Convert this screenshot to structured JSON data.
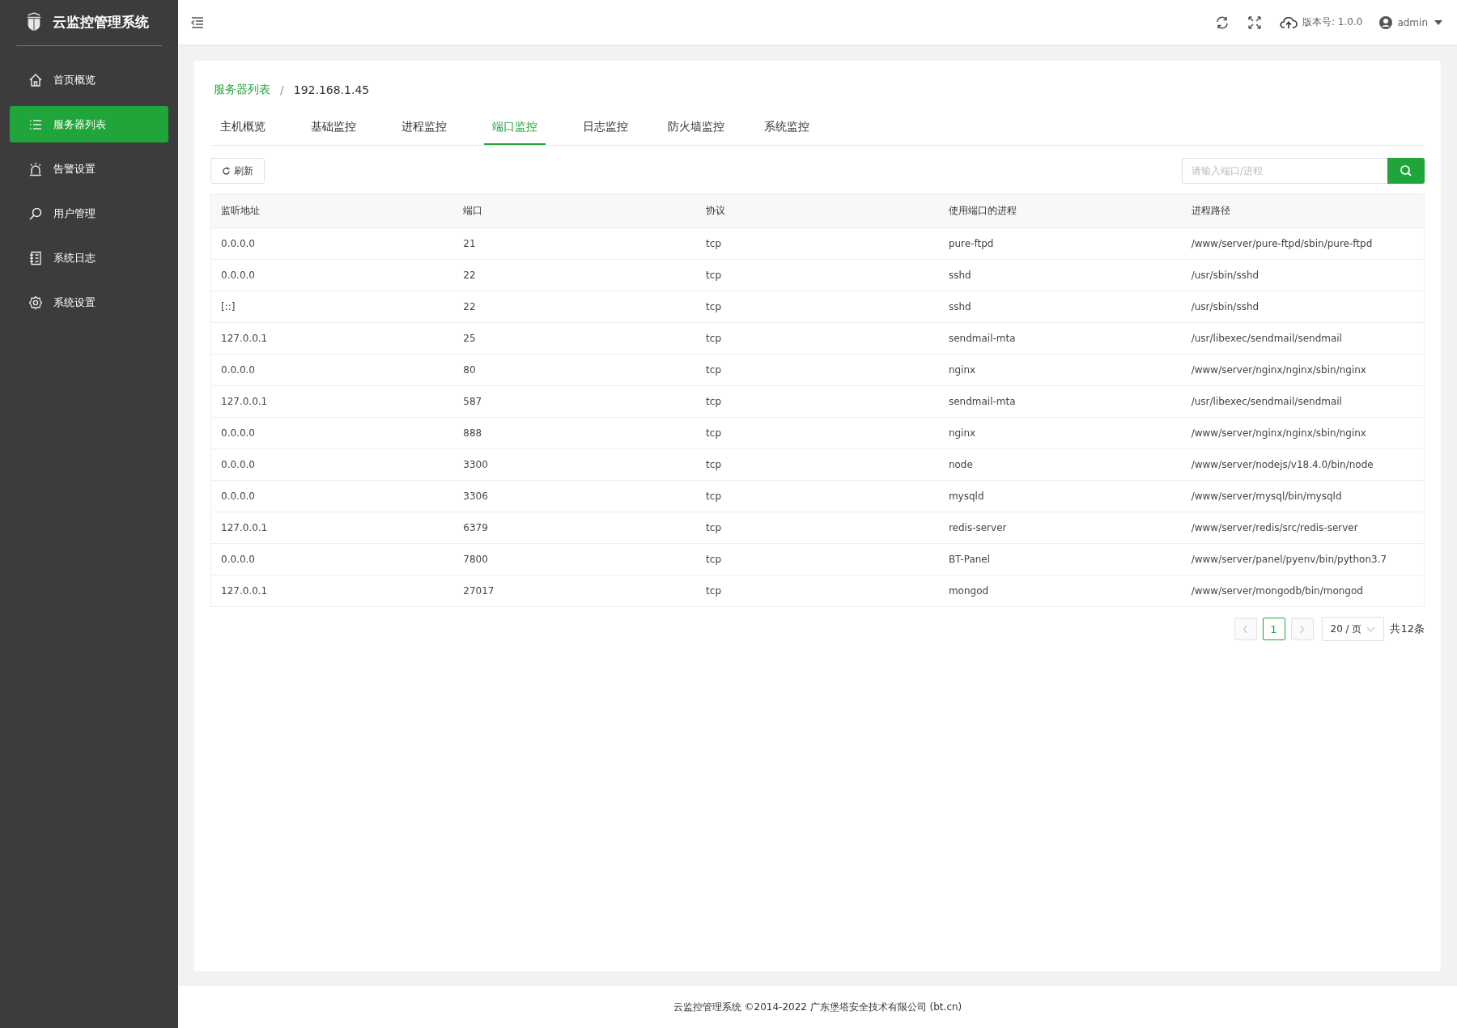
{
  "sidebar": {
    "title": "云监控管理系统",
    "items": [
      {
        "label": "首页概览",
        "selected": false
      },
      {
        "label": "服务器列表",
        "selected": true
      },
      {
        "label": "告警设置",
        "selected": false
      },
      {
        "label": "用户管理",
        "selected": false
      },
      {
        "label": "系统日志",
        "selected": false
      },
      {
        "label": "系统设置",
        "selected": false
      }
    ]
  },
  "header": {
    "version": "版本号: 1.0.0",
    "user": "admin"
  },
  "breadcrumb": {
    "items": [
      "服务器列表",
      "192.168.1.45"
    ],
    "separator": "/"
  },
  "tabs": [
    {
      "label": "主机概览",
      "selected": false
    },
    {
      "label": "基础监控",
      "selected": false
    },
    {
      "label": "进程监控",
      "selected": false
    },
    {
      "label": "端口监控",
      "selected": true
    },
    {
      "label": "日志监控",
      "selected": false
    },
    {
      "label": "防火墙监控",
      "selected": false
    },
    {
      "label": "系统监控",
      "selected": false
    }
  ],
  "refresh_button": "刷新",
  "search": {
    "placeholder": "请输入端口/进程"
  },
  "table": {
    "columns": [
      "监听地址",
      "端口",
      "协议",
      "使用端口的进程",
      "进程路径"
    ],
    "rows": [
      [
        "0.0.0.0",
        "21",
        "tcp",
        "pure-ftpd",
        "/www/server/pure-ftpd/sbin/pure-ftpd"
      ],
      [
        "0.0.0.0",
        "22",
        "tcp",
        "sshd",
        "/usr/sbin/sshd"
      ],
      [
        "[::]",
        "22",
        "tcp",
        "sshd",
        "/usr/sbin/sshd"
      ],
      [
        "127.0.0.1",
        "25",
        "tcp",
        "sendmail-mta",
        "/usr/libexec/sendmail/sendmail"
      ],
      [
        "0.0.0.0",
        "80",
        "tcp",
        "nginx",
        "/www/server/nginx/nginx/sbin/nginx"
      ],
      [
        "127.0.0.1",
        "587",
        "tcp",
        "sendmail-mta",
        "/usr/libexec/sendmail/sendmail"
      ],
      [
        "0.0.0.0",
        "888",
        "tcp",
        "nginx",
        "/www/server/nginx/nginx/sbin/nginx"
      ],
      [
        "0.0.0.0",
        "3300",
        "tcp",
        "node",
        "/www/server/nodejs/v18.4.0/bin/node"
      ],
      [
        "0.0.0.0",
        "3306",
        "tcp",
        "mysqld",
        "/www/server/mysql/bin/mysqld"
      ],
      [
        "127.0.0.1",
        "6379",
        "tcp",
        "redis-server",
        "/www/server/redis/src/redis-server"
      ],
      [
        "0.0.0.0",
        "7800",
        "tcp",
        "BT-Panel",
        "/www/server/panel/pyenv/bin/python3.7"
      ],
      [
        "127.0.0.1",
        "27017",
        "tcp",
        "mongod",
        "/www/server/mongodb/bin/mongod"
      ]
    ]
  },
  "pagination": {
    "pages": [
      {
        "label": "1",
        "selected": true
      }
    ],
    "page_size": "20 / 页",
    "total": "共12条"
  },
  "footer": "云监控管理系统 ©2014-2022 广东堡塔安全技术有限公司 (bt.cn)"
}
